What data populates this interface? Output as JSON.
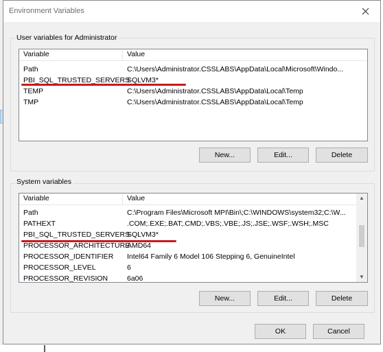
{
  "window": {
    "title": "Environment Variables"
  },
  "user": {
    "group_label": "User variables for Administrator",
    "col_variable": "Variable",
    "col_value": "Value",
    "rows": [
      {
        "name": "Path",
        "value": "C:\\Users\\Administrator.CSSLABS\\AppData\\Local\\Microsoft\\Windo..."
      },
      {
        "name": "PBI_SQL_TRUSTED_SERVERS",
        "value": "SQLVM3*"
      },
      {
        "name": "TEMP",
        "value": "C:\\Users\\Administrator.CSSLABS\\AppData\\Local\\Temp"
      },
      {
        "name": "TMP",
        "value": "C:\\Users\\Administrator.CSSLABS\\AppData\\Local\\Temp"
      }
    ],
    "buttons": {
      "new": "New...",
      "edit": "Edit...",
      "delete": "Delete"
    }
  },
  "system": {
    "group_label": "System variables",
    "col_variable": "Variable",
    "col_value": "Value",
    "rows": [
      {
        "name": "Path",
        "value": "C:\\Program Files\\Microsoft MPI\\Bin\\;C:\\WINDOWS\\system32;C:\\W..."
      },
      {
        "name": "PATHEXT",
        "value": ".COM;.EXE;.BAT;.CMD;.VBS;.VBE;.JS;.JSE;.WSF;.WSH;.MSC"
      },
      {
        "name": "PBI_SQL_TRUSTED_SERVERS",
        "value": "SQLVM3*"
      },
      {
        "name": "PROCESSOR_ARCHITECTURE",
        "value": "AMD64"
      },
      {
        "name": "PROCESSOR_IDENTIFIER",
        "value": "Intel64 Family 6 Model 106 Stepping 6, GenuineIntel"
      },
      {
        "name": "PROCESSOR_LEVEL",
        "value": "6"
      },
      {
        "name": "PROCESSOR_REVISION",
        "value": "6a06"
      }
    ],
    "buttons": {
      "new": "New...",
      "edit": "Edit...",
      "delete": "Delete"
    }
  },
  "footer": {
    "ok": "OK",
    "cancel": "Cancel"
  },
  "colors": {
    "annotation": "#c8191f",
    "button_face": "#e1e1e1",
    "window_bg": "#f0f0f0"
  },
  "icons": {
    "close": "close-icon",
    "scroll_up": "chevron-up-icon",
    "scroll_down": "chevron-down-icon"
  }
}
